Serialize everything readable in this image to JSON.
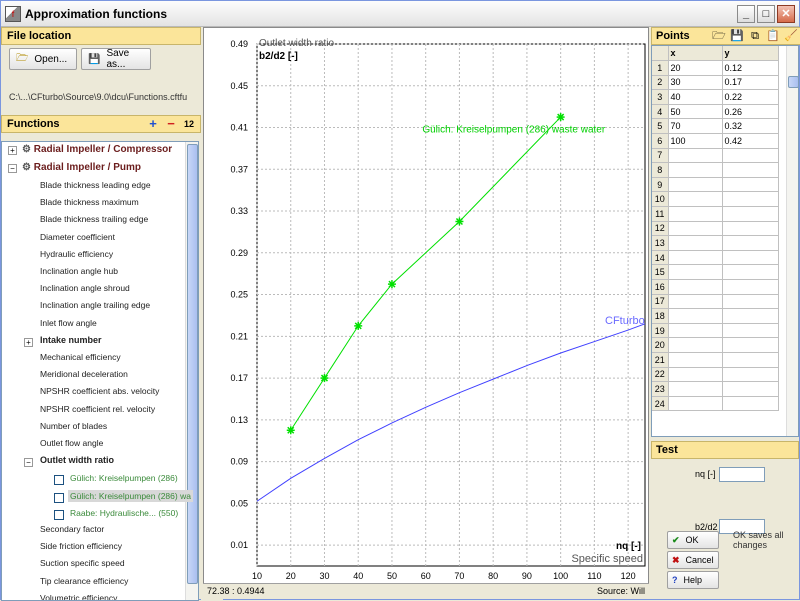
{
  "window": {
    "title": "Approximation functions"
  },
  "file_location": {
    "header": "File location",
    "open_label": "Open...",
    "save_label": "Save as...",
    "path": "C:\\...\\CFturbo\\Source\\9.0\\dcu\\Functions.cftfu"
  },
  "functions": {
    "header": "Functions",
    "add_symbol": "+",
    "remove_symbol": "−",
    "sort_symbol": "12",
    "tree": {
      "compressor": "Radial Impeller / Compressor",
      "pump": "Radial Impeller / Pump",
      "items": [
        "Blade thickness leading edge",
        "Blade thickness maximum",
        "Blade thickness trailing edge",
        "Diameter coefficient",
        "Hydraulic efficiency",
        "Inclination angle hub",
        "Inclination angle shroud",
        "Inclination angle trailing edge",
        "Inlet flow angle",
        "Intake number",
        "Mechanical efficiency",
        "Meridional deceleration",
        "NPSHR coefficient abs. velocity",
        "NPSHR coefficient rel. velocity",
        "Number of blades",
        "Outlet flow angle",
        "Outlet width ratio",
        "Secondary factor",
        "Side friction efficiency",
        "Suction specific speed",
        "Tip clearance efficiency",
        "Volumetric efficiency"
      ],
      "outlet_children": [
        "Gülich: Kreiselpumpen (286)",
        "Gülich: Kreiselpumpen (286) wa",
        "Raabe: Hydraulische... (550)"
      ]
    }
  },
  "chart_data": {
    "type": "line",
    "title": "",
    "ylabel": "b2/d2 [-]",
    "ylabel_desc": "Outlet width ratio",
    "xlabel": "nq [-]",
    "xlabel_desc": "Specific speed",
    "xlim": [
      10,
      125
    ],
    "ylim": [
      -0.01,
      0.49
    ],
    "x_ticks": [
      10,
      20,
      30,
      40,
      50,
      60,
      70,
      80,
      90,
      100,
      110,
      120
    ],
    "y_ticks": [
      0.01,
      0.05,
      0.09,
      0.13,
      0.17,
      0.21,
      0.25,
      0.29,
      0.33,
      0.37,
      0.41,
      0.45,
      0.49
    ],
    "grid": true,
    "series": [
      {
        "name": "Gülich: Kreiselpumpen (286) waste water",
        "color": "#00e000",
        "markers": true,
        "x": [
          20,
          30,
          40,
          50,
          70,
          100
        ],
        "y": [
          0.12,
          0.17,
          0.22,
          0.26,
          0.32,
          0.42
        ]
      },
      {
        "name": "CFturbo",
        "color": "#4040ff",
        "markers": false,
        "x": [
          10,
          20,
          30,
          40,
          50,
          60,
          70,
          80,
          90,
          100,
          110,
          120,
          125
        ],
        "y": [
          0.052,
          0.074,
          0.093,
          0.111,
          0.127,
          0.142,
          0.156,
          0.169,
          0.182,
          0.194,
          0.205,
          0.216,
          0.222
        ]
      }
    ]
  },
  "status": {
    "coords": "72.38 : 0.4944",
    "source": "Source: Will"
  },
  "points": {
    "header": "Points",
    "col_x": "x",
    "col_y": "y",
    "rows": [
      [
        "20",
        "0.12"
      ],
      [
        "30",
        "0.17"
      ],
      [
        "40",
        "0.22"
      ],
      [
        "50",
        "0.26"
      ],
      [
        "70",
        "0.32"
      ],
      [
        "100",
        "0.42"
      ]
    ],
    "row_count": 24
  },
  "test": {
    "header": "Test",
    "nq_label": "nq [-]",
    "b2d2_label": "b2/d2"
  },
  "actions": {
    "ok": "OK",
    "cancel": "Cancel",
    "help": "Help",
    "note": "OK saves all changes"
  }
}
